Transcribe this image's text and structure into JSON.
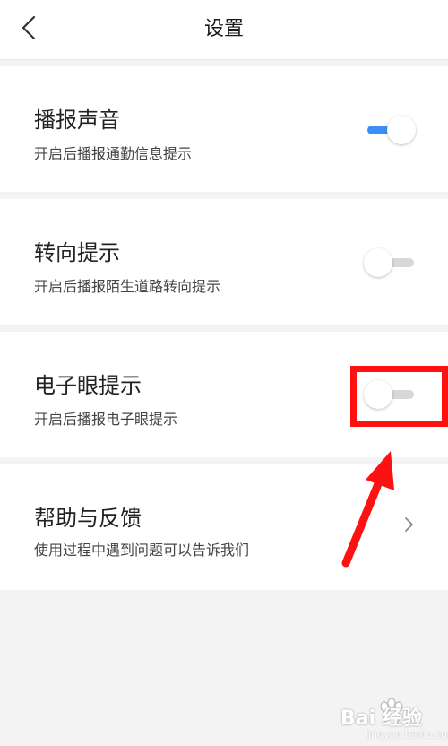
{
  "header": {
    "title": "设置"
  },
  "settings": [
    {
      "title": "播报声音",
      "description": "开启后播报通勤信息提示",
      "enabled": true
    },
    {
      "title": "转向提示",
      "description": "开启后播报陌生道路转向提示",
      "enabled": false
    },
    {
      "title": "电子眼提示",
      "description": "开启后播报电子眼提示",
      "enabled": false
    }
  ],
  "help": {
    "title": "帮助与反馈",
    "description": "使用过程中遇到问题可以告诉我们"
  },
  "watermark": {
    "brand": "Bai 经验",
    "url": "jingyan.baidu.com"
  },
  "colors": {
    "toggle_on": "#3a8ef6",
    "toggle_off": "#d8d8d8",
    "annotation_red": "#ff1111",
    "background": "#f3f3f3"
  }
}
